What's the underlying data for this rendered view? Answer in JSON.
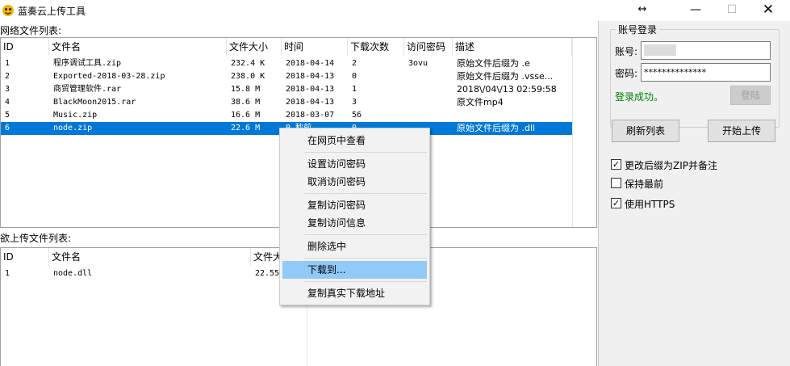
{
  "window": {
    "title": "蓝奏云上传工具",
    "controls": {
      "resize": "↔",
      "minimize": "—",
      "maximize": "☐",
      "close": "✕"
    }
  },
  "network_list": {
    "label": "网络文件列表:",
    "columns": [
      "ID",
      "文件名",
      "文件大小",
      "时间",
      "下载次数",
      "访问密码",
      "描述"
    ],
    "rows": [
      {
        "id": "1",
        "name": "程序调试工具.zip",
        "size": "232.4 K",
        "time": "2018-04-14",
        "downloads": "2",
        "password": "3ovu",
        "desc": "原始文件后缀为 .e"
      },
      {
        "id": "2",
        "name": "Exported-2018-03-28.zip",
        "size": "238.0 K",
        "time": "2018-04-13",
        "downloads": "0",
        "password": "",
        "desc": "原始文件后缀为 .vsse..."
      },
      {
        "id": "3",
        "name": "商贸管理软件.rar",
        "size": "15.8 M",
        "time": "2018-04-13",
        "downloads": "1",
        "password": "",
        "desc": "2018\\/04\\/13 02:59:58"
      },
      {
        "id": "4",
        "name": "BlackMoon2015.rar",
        "size": "38.6 M",
        "time": "2018-04-13",
        "downloads": "3",
        "password": "",
        "desc": "原文件mp4"
      },
      {
        "id": "5",
        "name": "Music.zip",
        "size": "16.6 M",
        "time": "2018-03-07",
        "downloads": "56",
        "password": "",
        "desc": ""
      },
      {
        "id": "6",
        "name": "node.zip",
        "size": "22.6 M",
        "time": "0 秒前",
        "downloads": "0",
        "password": "",
        "desc": "原始文件后缀为 .dll"
      }
    ]
  },
  "upload_list": {
    "label": "欲上传文件列表:",
    "columns": [
      "ID",
      "文件名",
      "文件大"
    ],
    "rows": [
      {
        "id": "1",
        "name": "node.dll",
        "size": "22.55"
      }
    ]
  },
  "account": {
    "group_title": "账号登录",
    "account_label": "账号:",
    "account_value": "",
    "password_label": "密码:",
    "password_value": "**************",
    "status": "登录成功。",
    "login_button": "登陆"
  },
  "actions": {
    "refresh_button": "刷新列表",
    "upload_button": "开始上传"
  },
  "options": [
    {
      "label": "更改后缀为ZIP并备注",
      "checked": true
    },
    {
      "label": "保持最前",
      "checked": false
    },
    {
      "label": "使用HTTPS",
      "checked": true
    }
  ],
  "context_menu": {
    "items": [
      "在网页中查看",
      "设置访问密码",
      "取消访问密码",
      "复制访问密码",
      "复制访问信息",
      "删除选中",
      "下载到...",
      "复制真实下载地址"
    ]
  },
  "colors": {
    "selection": "#0078d7",
    "menu_hover": "#91c9f7",
    "success": "#008000"
  }
}
